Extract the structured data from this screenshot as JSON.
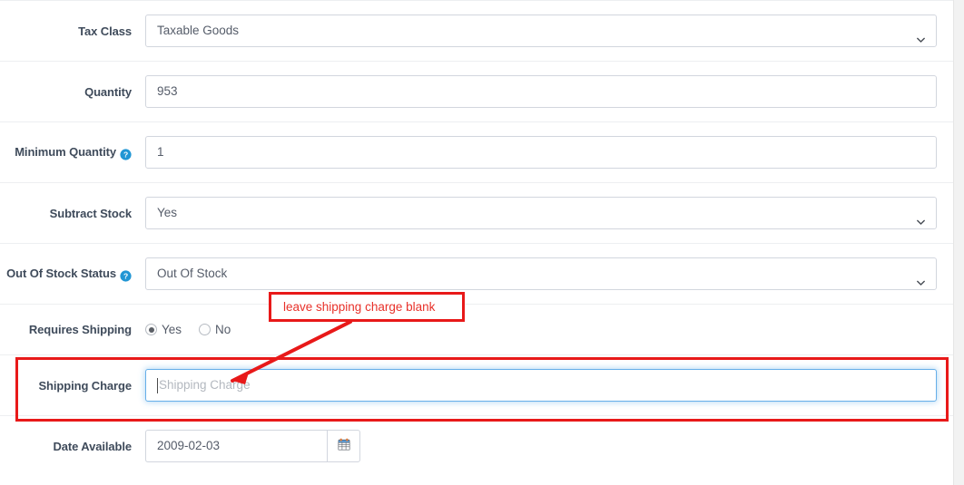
{
  "form": {
    "rows": [
      {
        "label": "Tax Class",
        "help": false,
        "type": "select",
        "value": "Taxable Goods",
        "icon": "chevron-down-icon",
        "name": "tax-class"
      },
      {
        "label": "Quantity",
        "help": false,
        "type": "text",
        "value": "953",
        "name": "quantity"
      },
      {
        "label": "Minimum Quantity",
        "help": true,
        "help_icon": "help-circle-icon",
        "type": "text",
        "value": "1",
        "name": "minimum-quantity"
      },
      {
        "label": "Subtract Stock",
        "help": false,
        "type": "select",
        "value": "Yes",
        "icon": "chevron-down-icon",
        "name": "subtract-stock"
      },
      {
        "label": "Out Of Stock Status",
        "help": true,
        "help_icon": "help-circle-icon",
        "type": "select",
        "value": "Out Of Stock",
        "icon": "chevron-down-icon",
        "name": "out-of-stock-status"
      }
    ],
    "requires_shipping": {
      "label": "Requires Shipping",
      "options": [
        {
          "label": "Yes",
          "checked": true
        },
        {
          "label": "No",
          "checked": false
        }
      ]
    },
    "shipping_charge": {
      "label": "Shipping Charge",
      "value": "",
      "placeholder": "Shipping Charge",
      "focused": true
    },
    "date_available": {
      "label": "Date Available",
      "value": "2009-02-03",
      "button_icon": "calendar-icon"
    }
  },
  "annotations": {
    "callout_text": "leave shipping charge blank",
    "callout_color": "#e8312a",
    "highlight_color": "#e81919",
    "arrow_icon": "arrow-pointer-line"
  }
}
